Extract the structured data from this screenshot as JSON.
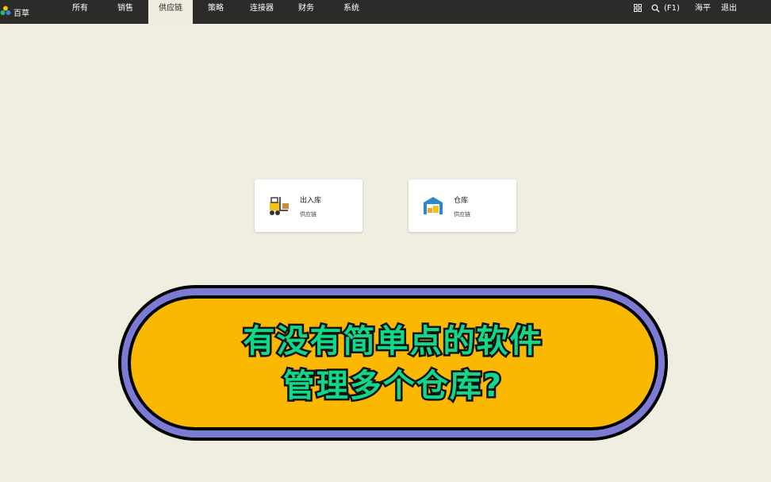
{
  "topbar": {
    "brand": "百草",
    "nav": [
      "所有",
      "销售",
      "供应链",
      "策略",
      "连接器",
      "财务",
      "系统"
    ],
    "active_nav": "供应链",
    "search_hint": "(F1)",
    "user": "海平",
    "logout": "退出"
  },
  "cards": [
    {
      "title": "出入库",
      "subtitle": "供应链",
      "icon": "forklift-icon"
    },
    {
      "title": "仓库",
      "subtitle": "供应链",
      "icon": "warehouse-icon"
    }
  ],
  "banner": {
    "line1": "有没有简单点的软件",
    "line2": "管理多个仓库?"
  },
  "colors": {
    "topbar": "#2c2b2a",
    "background": "#efece0",
    "banner_fill": "#fbb800",
    "banner_ring": "#7b7bd4",
    "banner_text": "#10d889"
  }
}
